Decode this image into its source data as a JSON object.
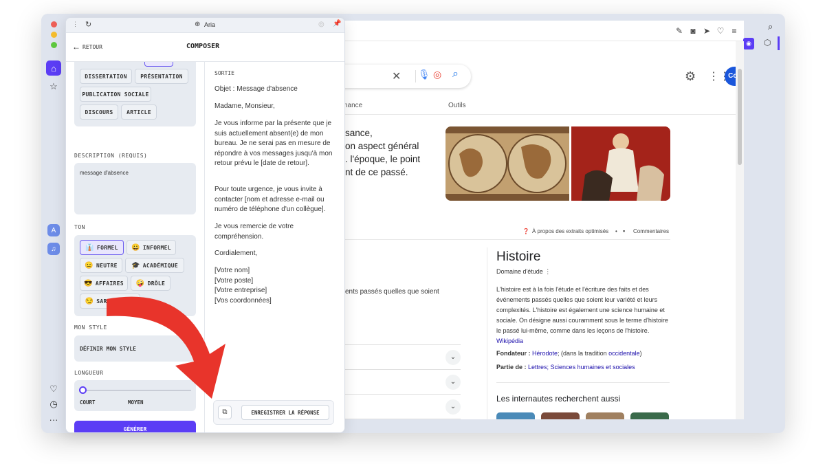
{
  "aria": {
    "window_title": "Aria",
    "back_label": "RETOUR",
    "header_title": "COMPOSER",
    "types": [
      "DISSERTATION",
      "PRÉSENTATION",
      "PUBLICATION SOCIALE",
      "DISCOURS",
      "ARTICLE"
    ],
    "description_label": "DESCRIPTION (REQUIS)",
    "description_value": "message d'absence",
    "tone_label": "TON",
    "tones": [
      {
        "label": "FORMEL",
        "emoji": "👔",
        "selected": true
      },
      {
        "label": "INFORMEL",
        "emoji": "😀",
        "selected": false
      },
      {
        "label": "NEUTRE",
        "emoji": "😐",
        "selected": false
      },
      {
        "label": "ACADÉMIQUE",
        "emoji": "🎓",
        "selected": false
      },
      {
        "label": "AFFAIRES",
        "emoji": "😎",
        "selected": false
      },
      {
        "label": "DRÔLE",
        "emoji": "🤪",
        "selected": false
      },
      {
        "label": "SARCASTIQUE",
        "emoji": "😏",
        "selected": false
      }
    ],
    "style_label": "MON STYLE",
    "style_button": "DÉFINIR MON STYLE",
    "length_label": "LONGUEUR",
    "length_options": [
      "COURT",
      "MOYEN"
    ],
    "length_value": 0,
    "generate_button": "GÉNÉRER",
    "output_label": "SORTIE",
    "output_paragraphs": [
      "Objet : Message d'absence",
      "Madame, Monsieur,",
      "Je vous informe par la présente que je suis actuellement absent(e) de mon bureau. Je ne serai pas en mesure de répondre à vos messages jusqu'à mon retour prévu le [date de retour].",
      "Pour toute urgence, je vous invite à contacter [nom et adresse e-mail ou numéro de téléphone d'un collègue].",
      "Je vous remercie de votre compréhension.",
      "Cordialement,",
      "[Votre nom]\n[Votre poste]\n[Votre entreprise]\n[Vos coordonnées]"
    ],
    "save_button": "ENREGISTRER LA RÉPONSE"
  },
  "google": {
    "connexion": "Connexion",
    "tab_partial": "nance",
    "tab_tools": "Outils",
    "snippet_lines": [
      "sance,",
      "on aspect général",
      ". l'époque, le point",
      "nt de ce passé."
    ],
    "about_snippets": "À propos des extraits optimisés",
    "feedback": "Commentaires",
    "partial_result": "ents passés quelles que soient",
    "kp_title": "Histoire",
    "kp_subtitle": "Domaine d'étude",
    "kp_desc": "L'histoire est à la fois l'étude et l'écriture des faits et des événements passés quelles que soient leur variété et leurs complexités. L'histoire est également une science humaine et sociale. On désigne aussi couramment sous le terme d'histoire le passé lui-même, comme dans les leçons de l'histoire.",
    "kp_wiki": "Wikipédia",
    "founder_label": "Fondateur :",
    "founder_link": "Hérodote",
    "founder_rest": "; (dans la tradition",
    "founder_link2": "occidentale",
    "partof_label": "Partie de :",
    "partof_links": "Lettres; Sciences humaines et sociales",
    "people_search": "Les internautes recherchent aussi"
  },
  "colors": {
    "accent": "#5b3df5",
    "google_blue": "#1a0dab",
    "arrow": "#e8342b"
  }
}
